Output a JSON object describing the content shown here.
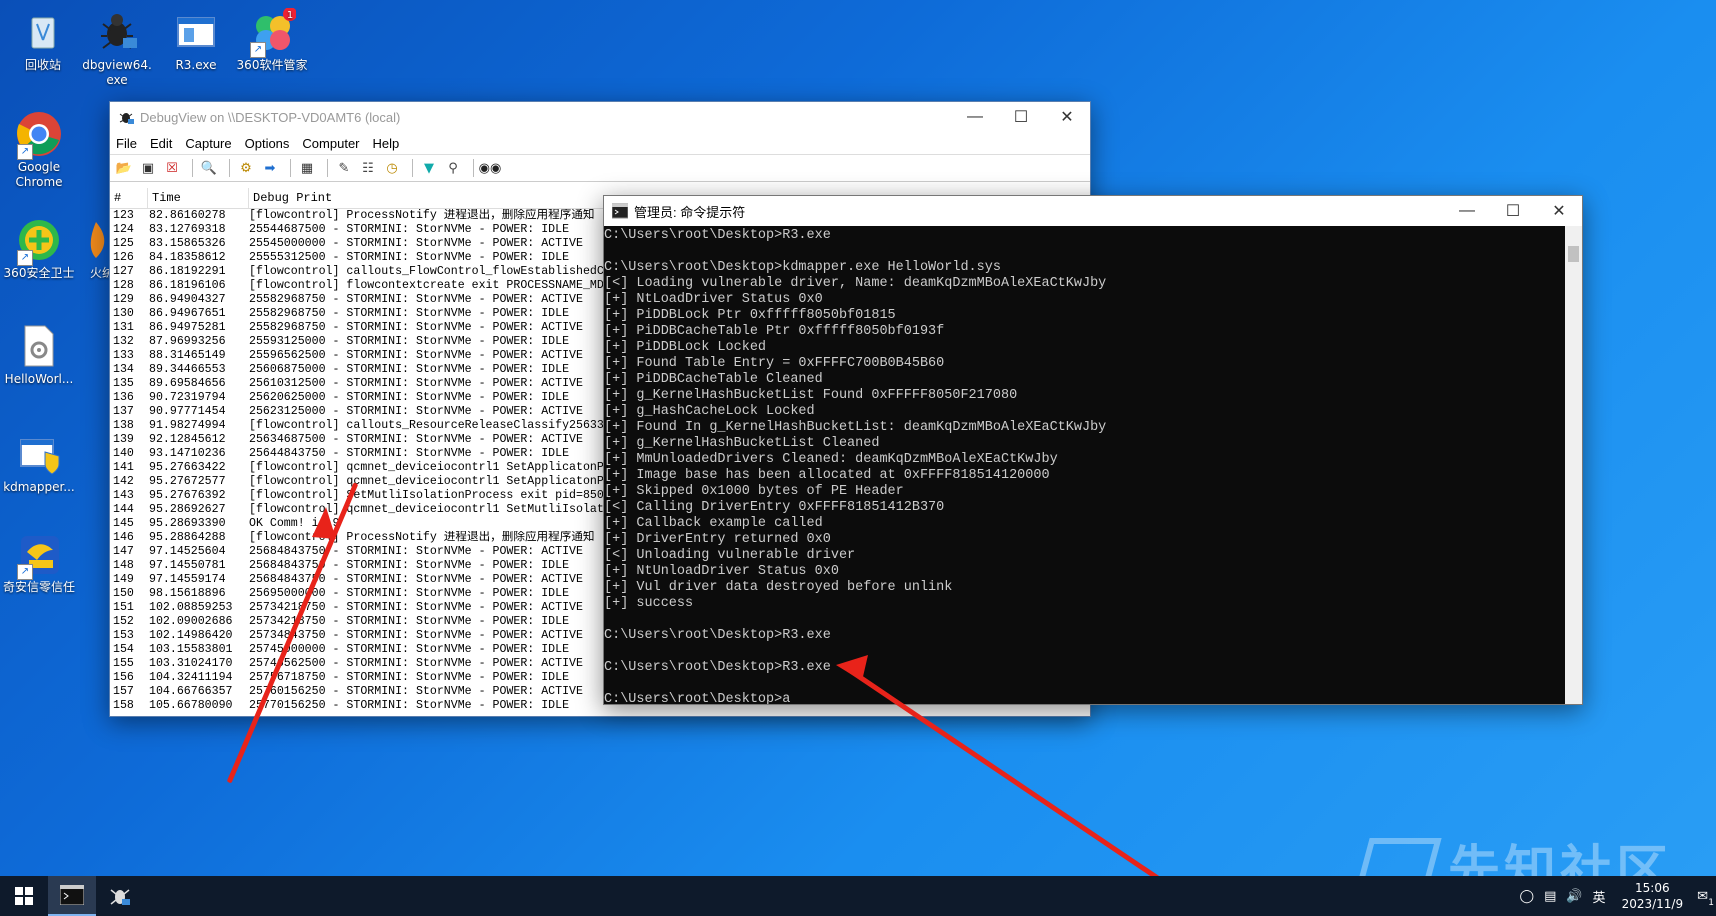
{
  "desktop": {
    "icons": [
      {
        "label": "回收站",
        "icon": "recycle-bin-icon"
      },
      {
        "label": "dbgview64.exe",
        "icon": "dbgview-bug-icon"
      },
      {
        "label": "R3.exe",
        "icon": "exe-window-icon"
      },
      {
        "label": "360软件管家",
        "icon": "flower-app-icon",
        "badge": "1"
      },
      {
        "label": "Google Chrome",
        "icon": "chrome-icon"
      },
      {
        "label": "360安全卫士",
        "icon": "360-shield-icon"
      },
      {
        "label": "火绒",
        "icon": "huorong-icon"
      },
      {
        "label": "HelloWorl...",
        "icon": "sys-file-gear-icon"
      },
      {
        "label": "kdmapper...",
        "icon": "exe-shield-icon"
      },
      {
        "label": "奇安信零信任",
        "icon": "qianxin-icon"
      }
    ]
  },
  "debugview": {
    "title": "DebugView on \\\\DESKTOP-VD0AMT6 (local)",
    "menu": [
      "File",
      "Edit",
      "Capture",
      "Options",
      "Computer",
      "Help"
    ],
    "columns": [
      "#",
      "Time",
      "Debug Print"
    ],
    "rows": [
      [
        "123",
        "82.86160278",
        "[flowcontrol] ProcessNotify 进程退出，删除应用程序通知"
      ],
      [
        "124",
        "83.12769318",
        "25544687500 - STORMINI: StorNVMe - POWER: IDLE"
      ],
      [
        "125",
        "83.15865326",
        "25545000000 - STORMINI: StorNVMe - POWER: ACTIVE"
      ],
      [
        "126",
        "84.18358612",
        "25555312500 - STORMINI: StorNVMe - POWER: IDLE"
      ],
      [
        "127",
        "86.18192291",
        "[flowcontrol] callouts_FlowControl_flowEstablishedC"
      ],
      [
        "128",
        "86.18196106",
        "[flowcontrol] flowcontextcreate exit PROCESSNAME_MD"
      ],
      [
        "129",
        "86.94904327",
        "25582968750 - STORMINI: StorNVMe - POWER: ACTIVE"
      ],
      [
        "130",
        "86.94967651",
        "25582968750 - STORMINI: StorNVMe - POWER: IDLE"
      ],
      [
        "131",
        "86.94975281",
        "25582968750 - STORMINI: StorNVMe - POWER: ACTIVE"
      ],
      [
        "132",
        "87.96993256",
        "25593125000 - STORMINI: StorNVMe - POWER: IDLE"
      ],
      [
        "133",
        "88.31465149",
        "25596562500 - STORMINI: StorNVMe - POWER: ACTIVE"
      ],
      [
        "134",
        "89.34466553",
        "25606875000 - STORMINI: StorNVMe - POWER: IDLE"
      ],
      [
        "135",
        "89.69584656",
        "25610312500 - STORMINI: StorNVMe - POWER: ACTIVE"
      ],
      [
        "136",
        "90.72319794",
        "25620625000 - STORMINI: StorNVMe - POWER: IDLE"
      ],
      [
        "137",
        "90.97771454",
        "25623125000 - STORMINI: StorNVMe - POWER: ACTIVE"
      ],
      [
        "138",
        "91.98274994",
        "[flowcontrol] callouts_ResourceReleaseClassify25633"
      ],
      [
        "139",
        "92.12845612",
        "25634687500 - STORMINI: StorNVMe - POWER: ACTIVE"
      ],
      [
        "140",
        "93.14710236",
        "25644843750 - STORMINI: StorNVMe - POWER: IDLE"
      ],
      [
        "141",
        "95.27663422",
        "[flowcontrol] qcmnet_deviceiocontrl1 SetApplicatonP"
      ],
      [
        "142",
        "95.27672577",
        "[flowcontrol] qcmnet_deviceiocontrl1 SetApplicatonP"
      ],
      [
        "143",
        "95.27676392",
        "[flowcontrol] SetMutliIsolationProcess exit pid=850"
      ],
      [
        "144",
        "95.28692627",
        "[flowcontrol] qcmnet_deviceiocontrl1 SetMutliIsolat"
      ],
      [
        "145",
        "95.28693390",
        "OK Comm! id:9"
      ],
      [
        "146",
        "95.28864288",
        "[flowcontrol] ProcessNotify 进程退出，删除应用程序通知"
      ],
      [
        "147",
        "97.14525604",
        "25684843750 - STORMINI: StorNVMe - POWER: ACTIVE"
      ],
      [
        "148",
        "97.14550781",
        "25684843750 - STORMINI: StorNVMe - POWER: IDLE"
      ],
      [
        "149",
        "97.14559174",
        "25684843750 - STORMINI: StorNVMe - POWER: ACTIVE"
      ],
      [
        "150",
        "98.15618896",
        "25695000000 - STORMINI: StorNVMe - POWER: IDLE"
      ],
      [
        "151",
        "102.08859253",
        "25734218750 - STORMINI: StorNVMe - POWER: ACTIVE"
      ],
      [
        "152",
        "102.09002686",
        "25734218750 - STORMINI: StorNVMe - POWER: IDLE"
      ],
      [
        "153",
        "102.14986420",
        "25734843750 - STORMINI: StorNVMe - POWER: ACTIVE"
      ],
      [
        "154",
        "103.15583801",
        "25745000000 - STORMINI: StorNVMe - POWER: IDLE"
      ],
      [
        "155",
        "103.31024170",
        "25746562500 - STORMINI: StorNVMe - POWER: ACTIVE"
      ],
      [
        "156",
        "104.32411194",
        "25756718750 - STORMINI: StorNVMe - POWER: IDLE"
      ],
      [
        "157",
        "104.66766357",
        "25760156250 - STORMINI: StorNVMe - POWER: ACTIVE"
      ],
      [
        "158",
        "105.66780090",
        "25770156250 - STORMINI: StorNVMe - POWER: IDLE"
      ]
    ]
  },
  "cmd": {
    "title": "管理员: 命令提示符",
    "lines": [
      "C:\\Users\\root\\Desktop>R3.exe",
      "",
      "C:\\Users\\root\\Desktop>kdmapper.exe HelloWorld.sys",
      "[<] Loading vulnerable driver, Name: deamKqDzmMBoAleXEaCtKwJby",
      "[+] NtLoadDriver Status 0x0",
      "[+] PiDDBLock Ptr 0xfffff8050bf01815",
      "[+] PiDDBCacheTable Ptr 0xfffff8050bf0193f",
      "[+] PiDDBLock Locked",
      "[+] Found Table Entry = 0xFFFFC700B0B45B60",
      "[+] PiDDBCacheTable Cleaned",
      "[+] g_KernelHashBucketList Found 0xFFFFF8050F217080",
      "[+] g_HashCacheLock Locked",
      "[+] Found In g_KernelHashBucketList: deamKqDzmMBoAleXEaCtKwJby",
      "[+] g_KernelHashBucketList Cleaned",
      "[+] MmUnloadedDrivers Cleaned: deamKqDzmMBoAleXEaCtKwJby",
      "[+] Image base has been allocated at 0xFFFF818514120000",
      "[+] Skipped 0x1000 bytes of PE Header",
      "[<] Calling DriverEntry 0xFFFF81851412B370",
      "[+] Callback example called",
      "[+] DriverEntry returned 0x0",
      "[<] Unloading vulnerable driver",
      "[+] NtUnloadDriver Status 0x0",
      "[+] Vul driver data destroyed before unlink",
      "[+] success",
      "",
      "C:\\Users\\root\\Desktop>R3.exe",
      "",
      "C:\\Users\\root\\Desktop>R3.exe",
      "",
      "C:\\Users\\root\\Desktop>a"
    ]
  },
  "taskbar": {
    "time": "15:06",
    "date": "2023/11/9",
    "ime": "英",
    "notification_count": "1"
  },
  "watermark": "先知社区",
  "colors": {
    "desktop": "#1a8ef0",
    "arrow": "#e8231a",
    "console_bg": "#0c0c0c",
    "console_fg": "#cccccc"
  }
}
